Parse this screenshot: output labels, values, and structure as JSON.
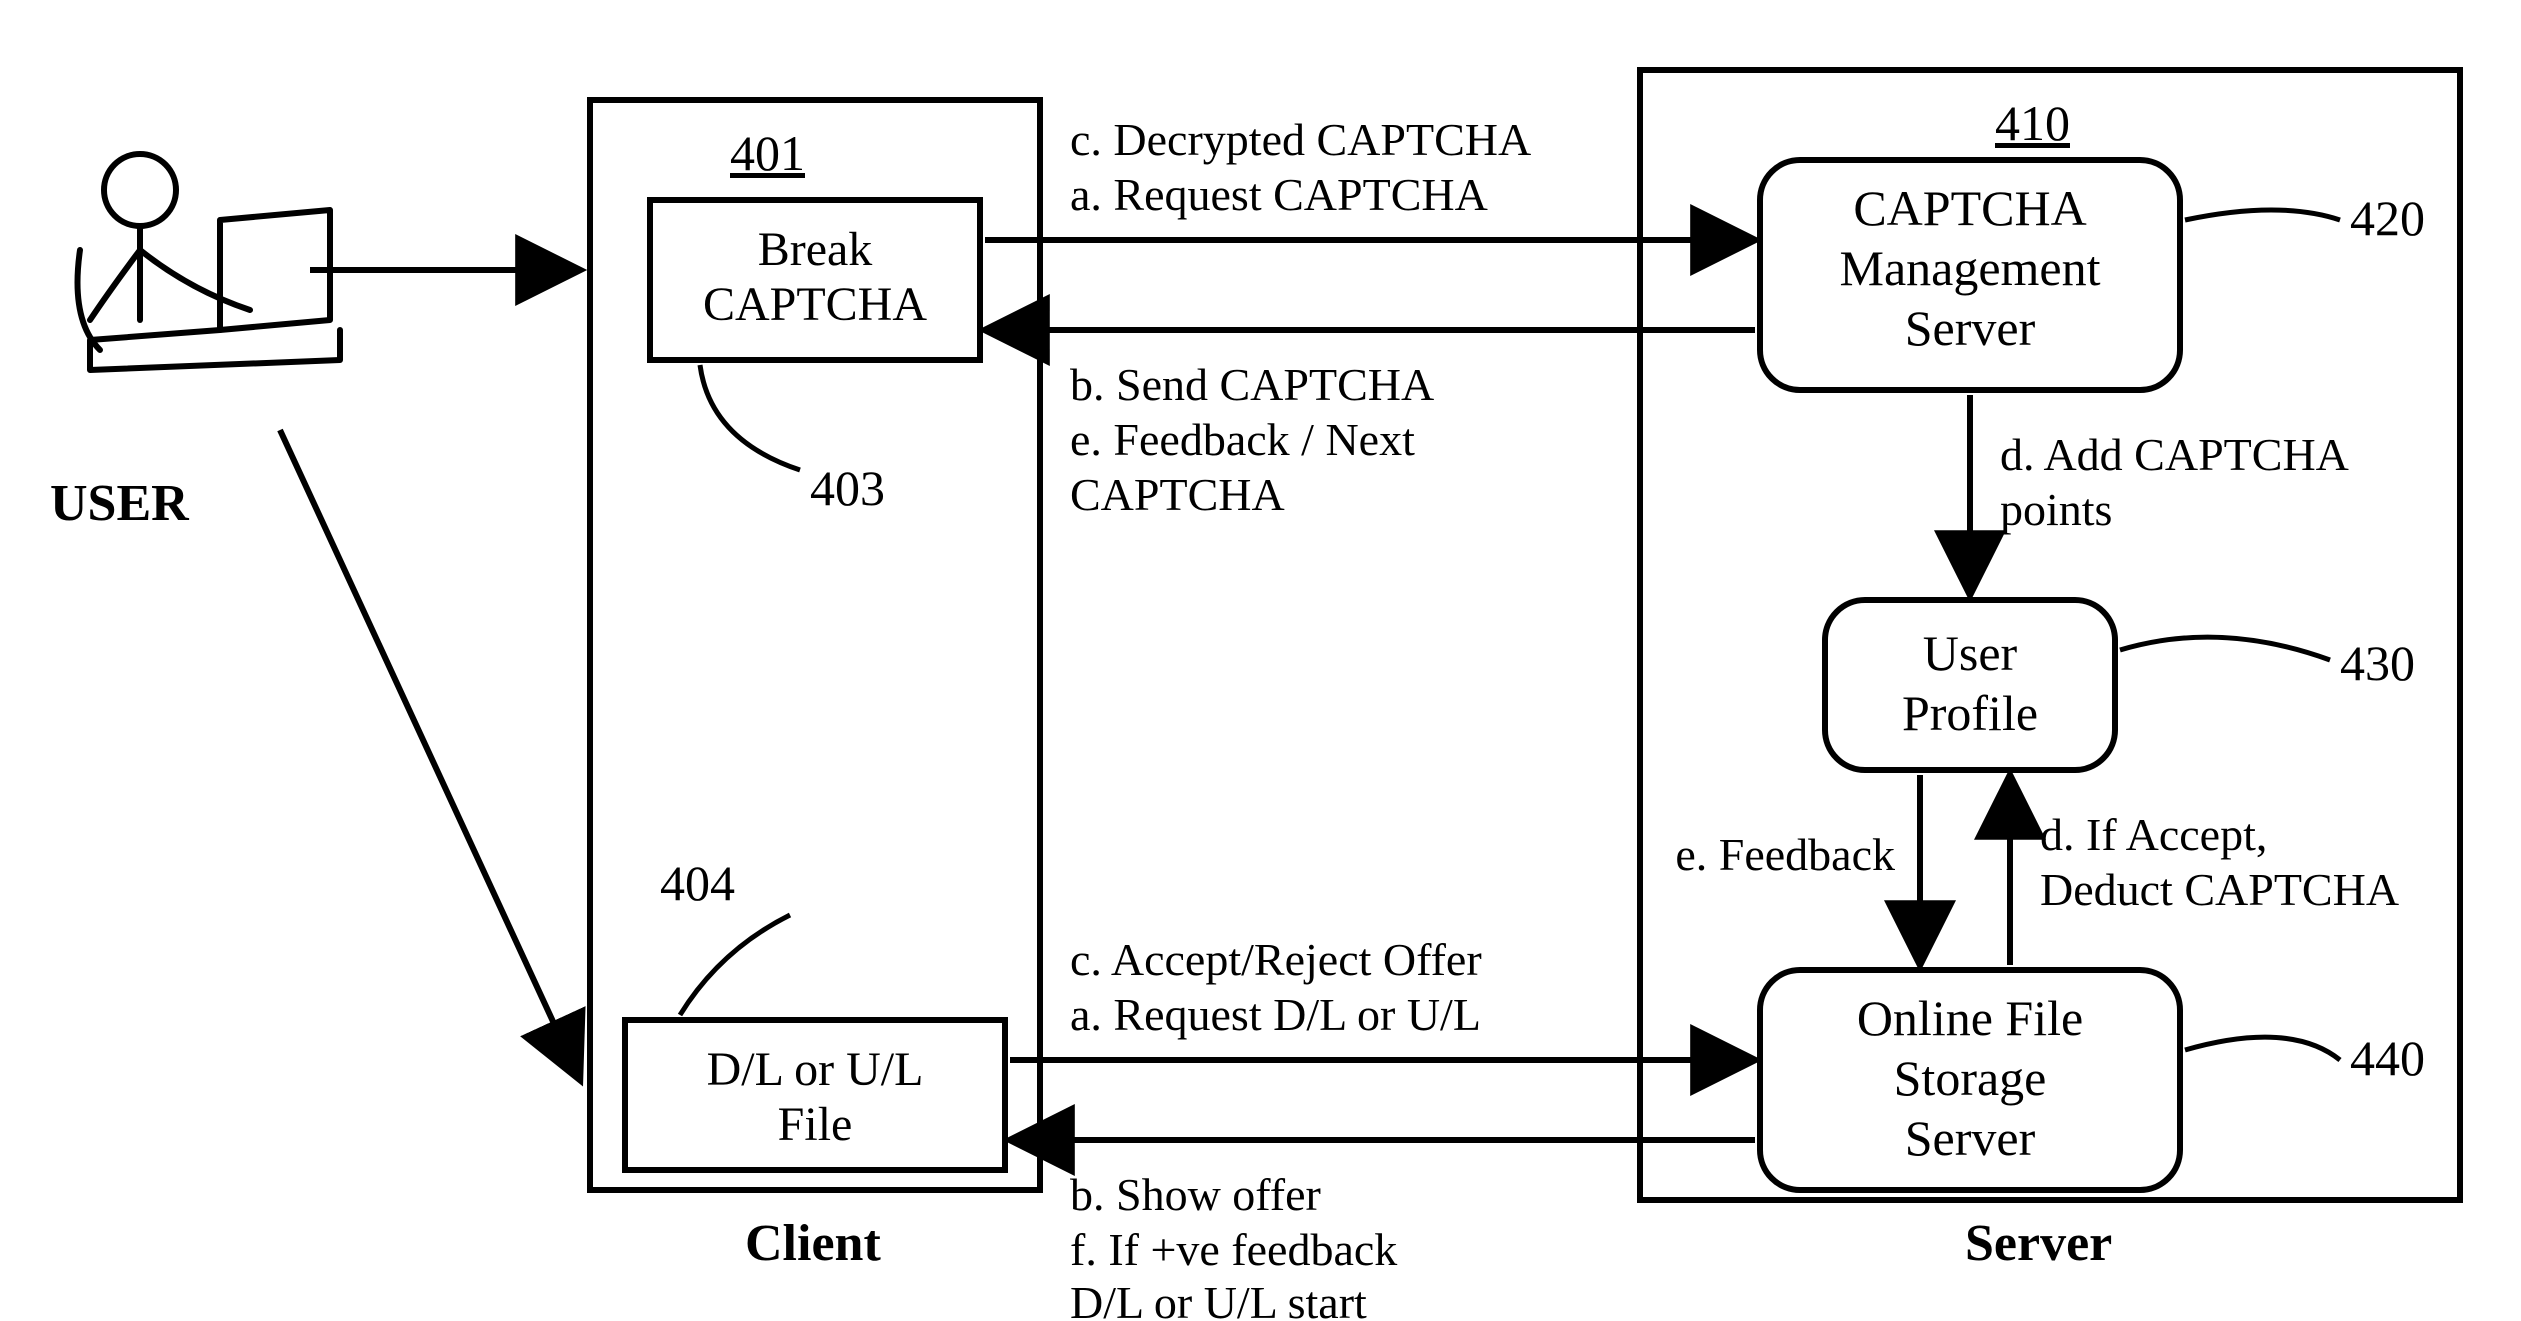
{
  "user_label": "USER",
  "client": {
    "title": "Client",
    "ref": "401",
    "break_captcha": {
      "line1": "Break",
      "line2": "CAPTCHA",
      "ref": "403"
    },
    "dl_ul": {
      "line1": "D/L or U/L",
      "line2": "File",
      "ref": "404"
    }
  },
  "server": {
    "title": "Server",
    "ref": "410",
    "captcha_mgmt": {
      "line1": "CAPTCHA",
      "line2": "Management",
      "line3": "Server",
      "ref": "420"
    },
    "user_profile": {
      "line1": "User",
      "line2": "Profile",
      "ref": "430"
    },
    "file_storage": {
      "line1": "Online File",
      "line2": "Storage",
      "line3": "Server",
      "ref": "440"
    }
  },
  "messages": {
    "top_fwd_1": "c. Decrypted CAPTCHA",
    "top_fwd_2": "a. Request CAPTCHA",
    "top_back_1": "b. Send CAPTCHA",
    "top_back_2": "e. Feedback / Next",
    "top_back_3": "CAPTCHA",
    "mgmt_to_profile_1": "d. Add CAPTCHA",
    "mgmt_to_profile_2": "points",
    "profile_storage_left": "e. Feedback",
    "profile_storage_right_1": "d. If Accept,",
    "profile_storage_right_2": "Deduct CAPTCHA",
    "bot_fwd_1": "c. Accept/Reject Offer",
    "bot_fwd_2": "a. Request D/L or U/L",
    "bot_back_1": "b. Show offer",
    "bot_back_2": "f. If +ve feedback",
    "bot_back_3": "D/L or U/L start"
  }
}
